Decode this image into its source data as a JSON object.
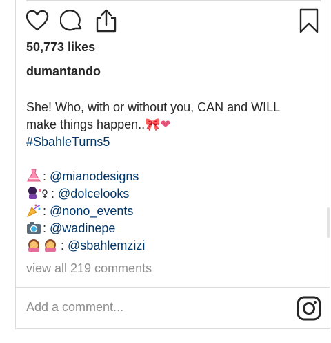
{
  "post": {
    "likes": "50,773 likes",
    "author": "dumantando",
    "caption_line1": "She! Who, with or without you, CAN and WILL",
    "caption_line2": "make things happen..",
    "caption_emojis": "🎀❤",
    "hashtag": "#SbahleTurns5",
    "credits": [
      {
        "icon": "dress-emoji",
        "sep": ":",
        "handle": "@mianodesigns"
      },
      {
        "icon": "nail-polish-emoji",
        "sep": ":",
        "handle": "@dolcelooks"
      },
      {
        "icon": "party-popper-emoji",
        "sep": ":",
        "handle": "@nono_events"
      },
      {
        "icon": "camera-emoji",
        "sep": ":",
        "handle": "@wadinepe"
      },
      {
        "icon": "girls-emoji",
        "sep": ":",
        "handle": "@sbahlemzizi"
      }
    ],
    "view_comments": "view all 219 comments",
    "add_comment_placeholder": "Add a comment..."
  },
  "icons": [
    "heart-icon",
    "comment-icon",
    "share-icon",
    "bookmark-icon",
    "instagram-icon"
  ],
  "colors": {
    "text": "#262626",
    "muted": "#8e8e8e",
    "link": "#00376b",
    "border": "#dbdbdb"
  }
}
